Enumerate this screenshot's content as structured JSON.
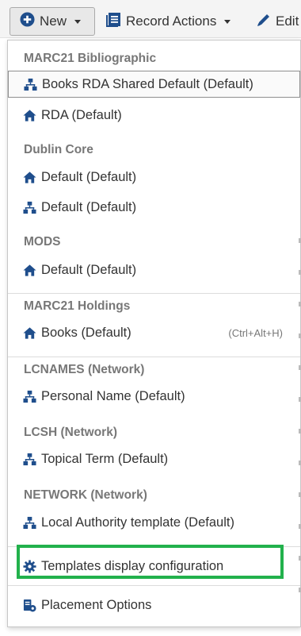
{
  "toolbar": {
    "new_label": "New",
    "record_actions_label": "Record Actions",
    "edit_label": "Edit"
  },
  "menu": {
    "groups": [
      {
        "header": "MARC21 Bibliographic",
        "items": [
          {
            "label": "Books RDA Shared Default (Default)",
            "icon": "network-icon"
          },
          {
            "label": "RDA (Default)",
            "icon": "home-icon"
          }
        ]
      },
      {
        "header": "Dublin Core",
        "items": [
          {
            "label": "Default (Default)",
            "icon": "home-icon"
          },
          {
            "label": "Default (Default)",
            "icon": "network-icon"
          }
        ]
      },
      {
        "header": "MODS",
        "items": [
          {
            "label": "Default (Default)",
            "icon": "home-icon"
          }
        ]
      },
      {
        "header": "MARC21 Holdings",
        "items": [
          {
            "label": "Books (Default)",
            "icon": "home-icon",
            "shortcut": "(Ctrl+Alt+H)"
          }
        ]
      },
      {
        "header": "LCNAMES (Network)",
        "items": [
          {
            "label": "Personal Name (Default)",
            "icon": "network-icon"
          }
        ]
      },
      {
        "header": "LCSH (Network)",
        "items": [
          {
            "label": "Topical Term (Default)",
            "icon": "network-icon"
          }
        ]
      },
      {
        "header": "NETWORK (Network)",
        "items": [
          {
            "label": "Local Authority template (Default)",
            "icon": "network-icon"
          }
        ]
      }
    ],
    "templates_config_label": "Templates display configuration",
    "placement_options_label": "Placement Options"
  },
  "colors": {
    "accent_blue": "#1f4e8c",
    "highlight_green": "#22b14c",
    "header_gray": "#777777"
  }
}
